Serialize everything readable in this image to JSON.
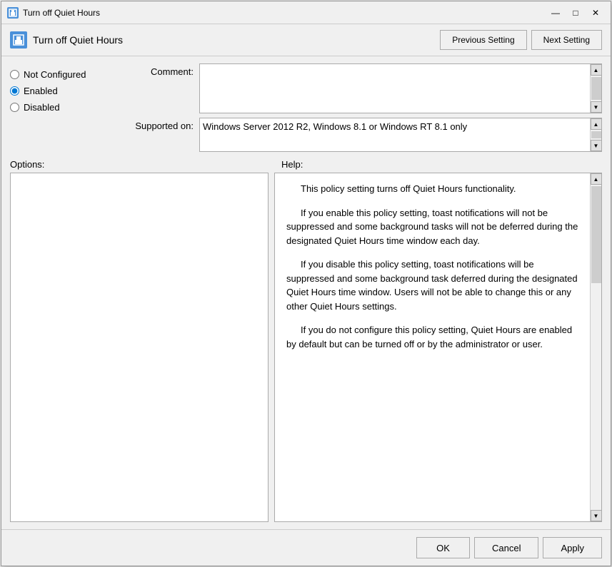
{
  "titleBar": {
    "title": "Turn off Quiet Hours",
    "minimize": "—",
    "maximize": "□",
    "close": "✕"
  },
  "header": {
    "title": "Turn off Quiet Hours",
    "prevButton": "Previous Setting",
    "nextButton": "Next Setting"
  },
  "radioGroup": {
    "notConfigured": "Not Configured",
    "enabled": "Enabled",
    "disabled": "Disabled",
    "selected": "enabled"
  },
  "fields": {
    "commentLabel": "Comment:",
    "commentValue": "",
    "supportedLabel": "Supported on:",
    "supportedValue": "Windows Server 2012 R2, Windows 8.1 or Windows RT 8.1 only"
  },
  "sections": {
    "optionsLabel": "Options:",
    "helpLabel": "Help:"
  },
  "helpText": {
    "para1": "This policy setting turns off Quiet Hours functionality.",
    "para2": "If you enable this policy setting, toast notifications will not be suppressed and some background tasks will not be deferred during the designated Quiet Hours time window each day.",
    "para3": "If you disable this policy setting, toast notifications will be suppressed and some background task deferred during the designated Quiet Hours time window.  Users will not be able to change this or any other Quiet Hours settings.",
    "para4": "If you do not configure this policy setting, Quiet Hours are enabled by default but can be turned off or by the administrator or user."
  },
  "footer": {
    "ok": "OK",
    "cancel": "Cancel",
    "apply": "Apply"
  }
}
